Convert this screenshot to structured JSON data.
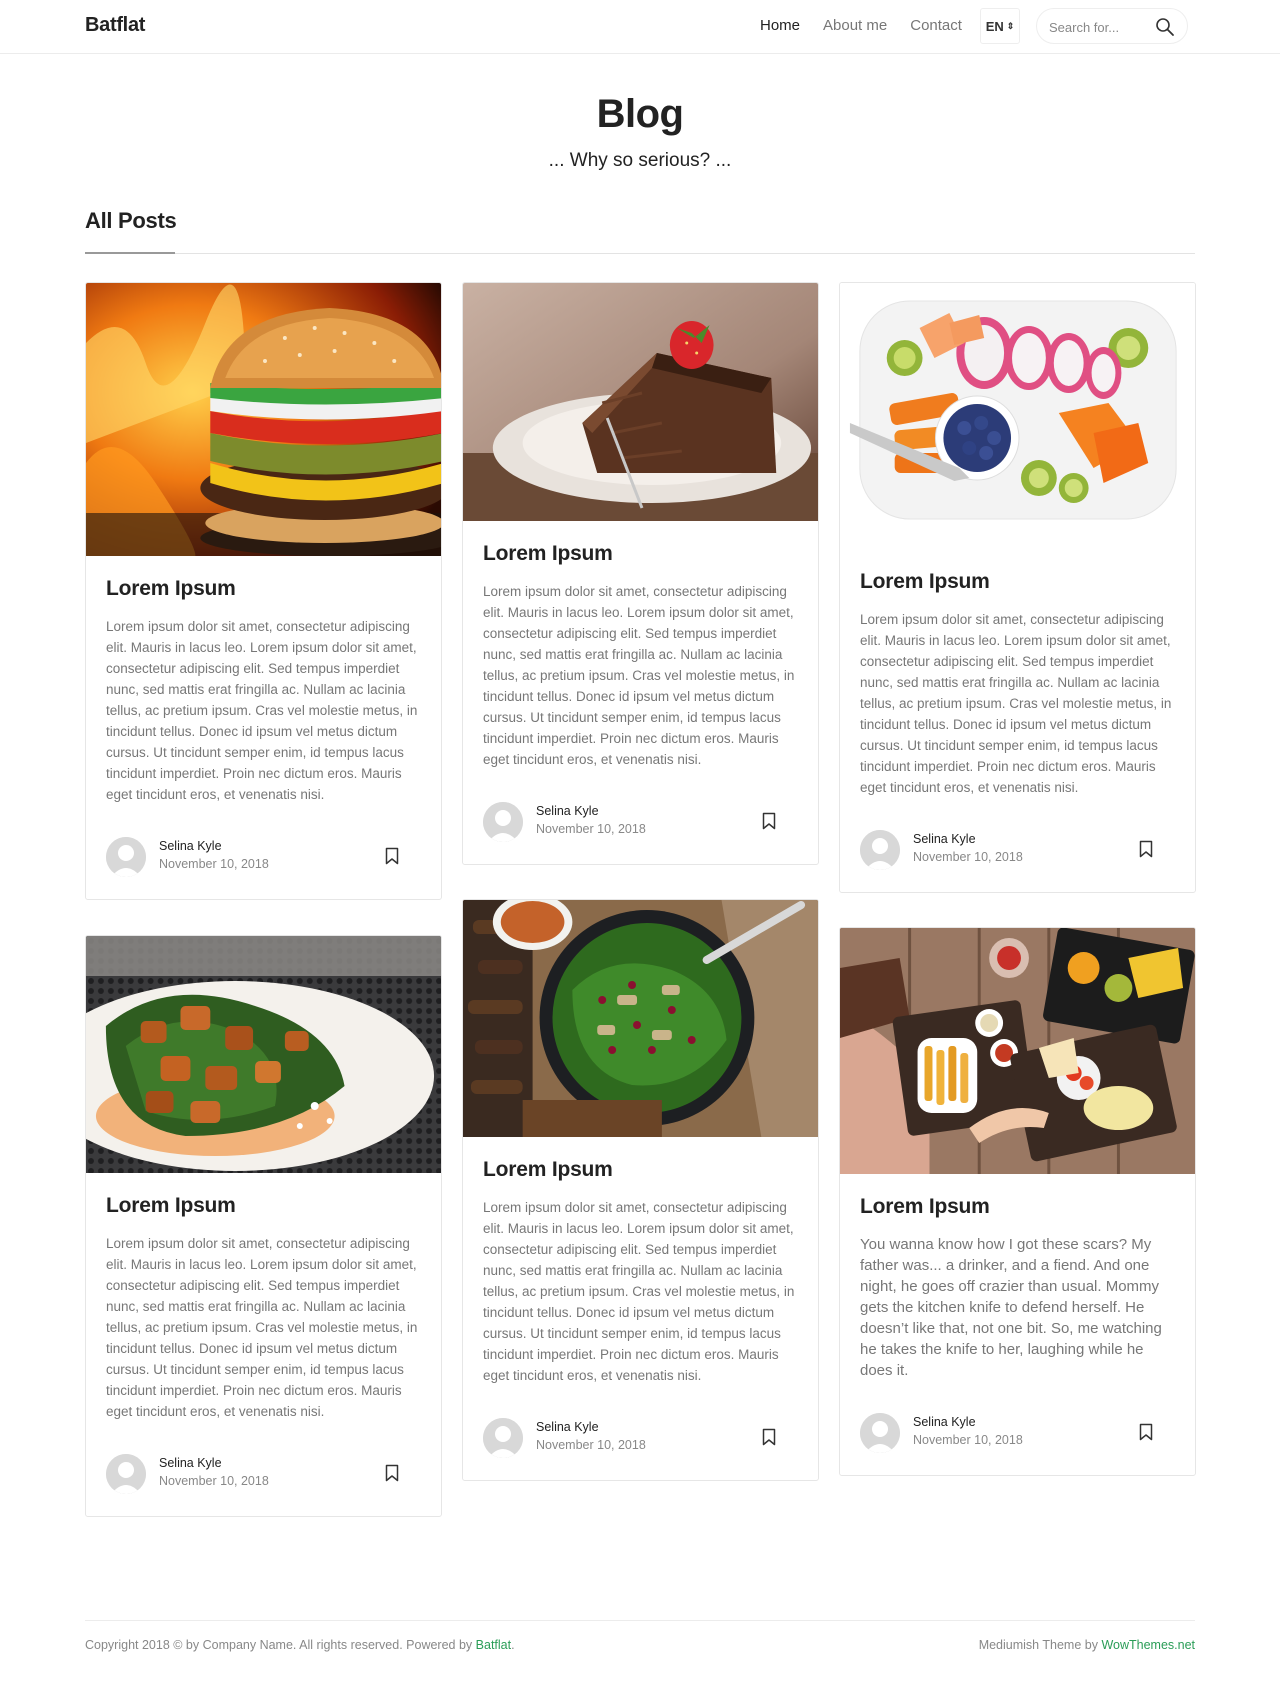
{
  "nav": {
    "brand": "Batflat",
    "links": [
      "Home",
      "About me",
      "Contact"
    ],
    "language": "EN",
    "search_placeholder": "Search for..."
  },
  "hero": {
    "title": "Blog",
    "subtitle": "... Why so serious? ..."
  },
  "section": {
    "title": "All Posts"
  },
  "posts": [
    {
      "title": "Lorem Ipsum",
      "image": "burger-photo",
      "excerpt": "Lorem ipsum dolor sit amet, consectetur adipiscing elit. Mauris in lacus leo. Lorem ipsum dolor sit amet, consectetur adipiscing elit. Sed tempus imperdiet nunc, sed mattis erat fringilla ac. Nullam ac lacinia tellus, ac pretium ipsum. Cras vel molestie metus, in tincidunt tellus. Donec id ipsum vel metus dictum cursus. Ut tincidunt semper enim, id tempus lacus tincidunt imperdiet. Proin nec dictum eros. Mauris eget tincidunt eros, et venenatis nisi.",
      "author": "Selina Kyle",
      "date": "November 10, 2018"
    },
    {
      "title": "Lorem Ipsum",
      "image": "chocolate-cake-photo",
      "excerpt": "Lorem ipsum dolor sit amet, consectetur adipiscing elit. Mauris in lacus leo. Lorem ipsum dolor sit amet, consectetur adipiscing elit. Sed tempus imperdiet nunc, sed mattis erat fringilla ac. Nullam ac lacinia tellus, ac pretium ipsum. Cras vel molestie metus, in tincidunt tellus. Donec id ipsum vel metus dictum cursus. Ut tincidunt semper enim, id tempus lacus tincidunt imperdiet. Proin nec dictum eros. Mauris eget tincidunt eros, et venenatis nisi.",
      "author": "Selina Kyle",
      "date": "November 10, 2018"
    },
    {
      "title": "Lorem Ipsum",
      "image": "fruit-platter-photo",
      "excerpt": "Lorem ipsum dolor sit amet, consectetur adipiscing elit. Mauris in lacus leo. Lorem ipsum dolor sit amet, consectetur adipiscing elit. Sed tempus imperdiet nunc, sed mattis erat fringilla ac. Nullam ac lacinia tellus, ac pretium ipsum. Cras vel molestie metus, in tincidunt tellus. Donec id ipsum vel metus dictum cursus. Ut tincidunt semper enim, id tempus lacus tincidunt imperdiet. Proin nec dictum eros. Mauris eget tincidunt eros, et venenatis nisi.",
      "author": "Selina Kyle",
      "date": "November 10, 2018"
    },
    {
      "title": "Lorem Ipsum",
      "image": "chicken-salad-photo",
      "excerpt": "Lorem ipsum dolor sit amet, consectetur adipiscing elit. Mauris in lacus leo. Lorem ipsum dolor sit amet, consectetur adipiscing elit. Sed tempus imperdiet nunc, sed mattis erat fringilla ac. Nullam ac lacinia tellus, ac pretium ipsum. Cras vel molestie metus, in tincidunt tellus. Donec id ipsum vel metus dictum cursus. Ut tincidunt semper enim, id tempus lacus tincidunt imperdiet. Proin nec dictum eros. Mauris eget tincidunt eros, et venenatis nisi.",
      "author": "Selina Kyle",
      "date": "November 10, 2018"
    },
    {
      "title": "Lorem Ipsum",
      "image": "spinach-salad-photo",
      "excerpt": "Lorem ipsum dolor sit amet, consectetur adipiscing elit. Mauris in lacus leo. Lorem ipsum dolor sit amet, consectetur adipiscing elit. Sed tempus imperdiet nunc, sed mattis erat fringilla ac. Nullam ac lacinia tellus, ac pretium ipsum. Cras vel molestie metus, in tincidunt tellus. Donec id ipsum vel metus dictum cursus. Ut tincidunt semper enim, id tempus lacus tincidunt imperdiet. Proin nec dictum eros. Mauris eget tincidunt eros, et venenatis nisi.",
      "author": "Selina Kyle",
      "date": "November 10, 2018"
    },
    {
      "title": "Lorem Ipsum",
      "image": "table-food-photo",
      "excerpt": "You wanna know how I got these scars? My father was... a drinker, and a fiend. And one night, he goes off crazier than usual. Mommy gets the kitchen knife to defend herself. He doesn’t like that, not one bit. So, me watching he takes the knife to her, laughing while he does it.",
      "author": "Selina Kyle",
      "date": "November 10, 2018"
    }
  ],
  "footer": {
    "copyright": "Copyright 2018 © by Company Name. All rights reserved. Powered by ",
    "powered_link": "Batflat",
    "period": ".",
    "theme_text": "Mediumish Theme by ",
    "theme_link": "WowThemes.net"
  },
  "colors": {
    "accent_link": "#2a9d57",
    "text_muted": "#777777",
    "text_dark": "#222222"
  }
}
